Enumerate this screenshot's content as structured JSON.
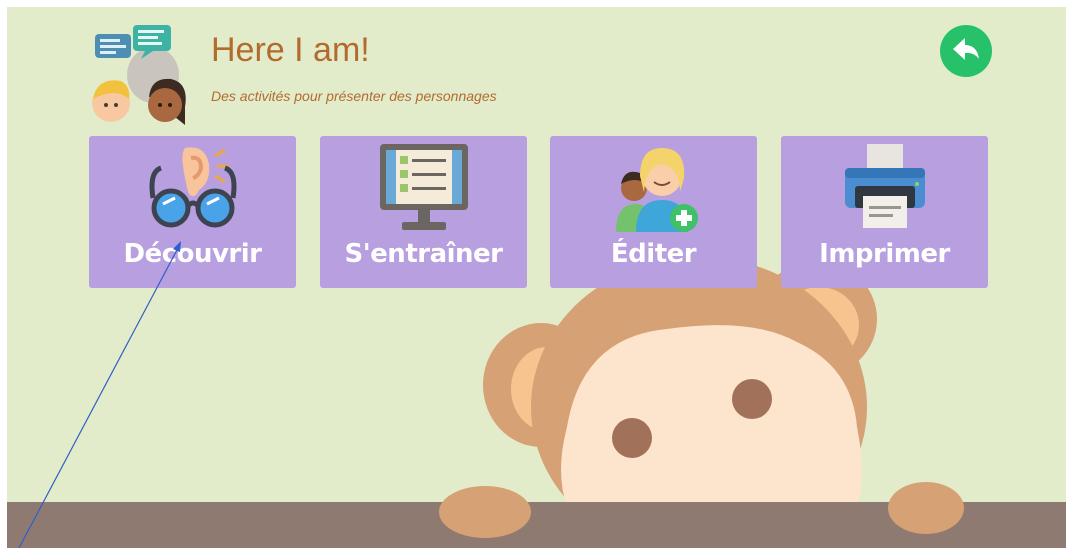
{
  "header": {
    "title": "Here I am!",
    "subtitle": "Des activités pour présenter des personnages",
    "logo_icon": "speech-bubbles-characters-icon",
    "back_icon": "back-arrow-icon"
  },
  "tiles": [
    {
      "label": "Découvrir",
      "icon": "ear-glasses-icon"
    },
    {
      "label": "S'entraîner",
      "icon": "checklist-screen-icon"
    },
    {
      "label": "Éditer",
      "icon": "add-user-icon"
    },
    {
      "label": "Imprimer",
      "icon": "printer-icon"
    }
  ],
  "colors": {
    "background": "#e2eccb",
    "tile": "#b79fe0",
    "title": "#b36b2d",
    "back_button": "#27c16a",
    "ground": "#8f7a72",
    "monkey_fur": "#d6a174",
    "monkey_face": "#fde4cd"
  }
}
